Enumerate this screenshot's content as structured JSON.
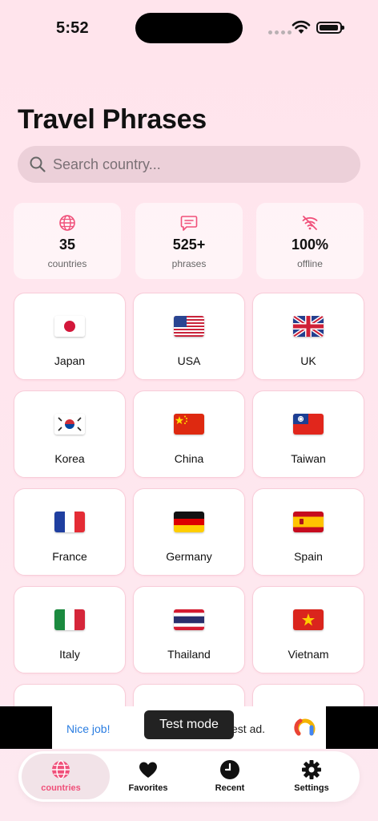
{
  "status": {
    "time": "5:52"
  },
  "title": "Travel Phrases",
  "search": {
    "placeholder": "Search country..."
  },
  "stats": [
    {
      "value": "35",
      "label": "countries",
      "icon": "globe-icon"
    },
    {
      "value": "525+",
      "label": "phrases",
      "icon": "chat-icon"
    },
    {
      "value": "100%",
      "label": "offline",
      "icon": "wifi-off-icon"
    }
  ],
  "countries": [
    {
      "name": "Japan"
    },
    {
      "name": "USA"
    },
    {
      "name": "UK"
    },
    {
      "name": "Korea"
    },
    {
      "name": "China"
    },
    {
      "name": "Taiwan"
    },
    {
      "name": "France"
    },
    {
      "name": "Germany"
    },
    {
      "name": "Spain"
    },
    {
      "name": "Italy"
    },
    {
      "name": "Thailand"
    },
    {
      "name": "Vietnam"
    }
  ],
  "ad": {
    "nice": "Nice job!",
    "text": "est ad.",
    "test_mode": "Test mode"
  },
  "nav": [
    {
      "label": "countries",
      "icon": "globe-icon",
      "active": true
    },
    {
      "label": "Favorites",
      "icon": "heart-icon"
    },
    {
      "label": "Recent",
      "icon": "clock-icon"
    },
    {
      "label": "Settings",
      "icon": "gear-icon"
    }
  ],
  "colors": {
    "accent": "#f0507a",
    "background": "#ffe4ec",
    "card_border": "#f8cdd9"
  }
}
